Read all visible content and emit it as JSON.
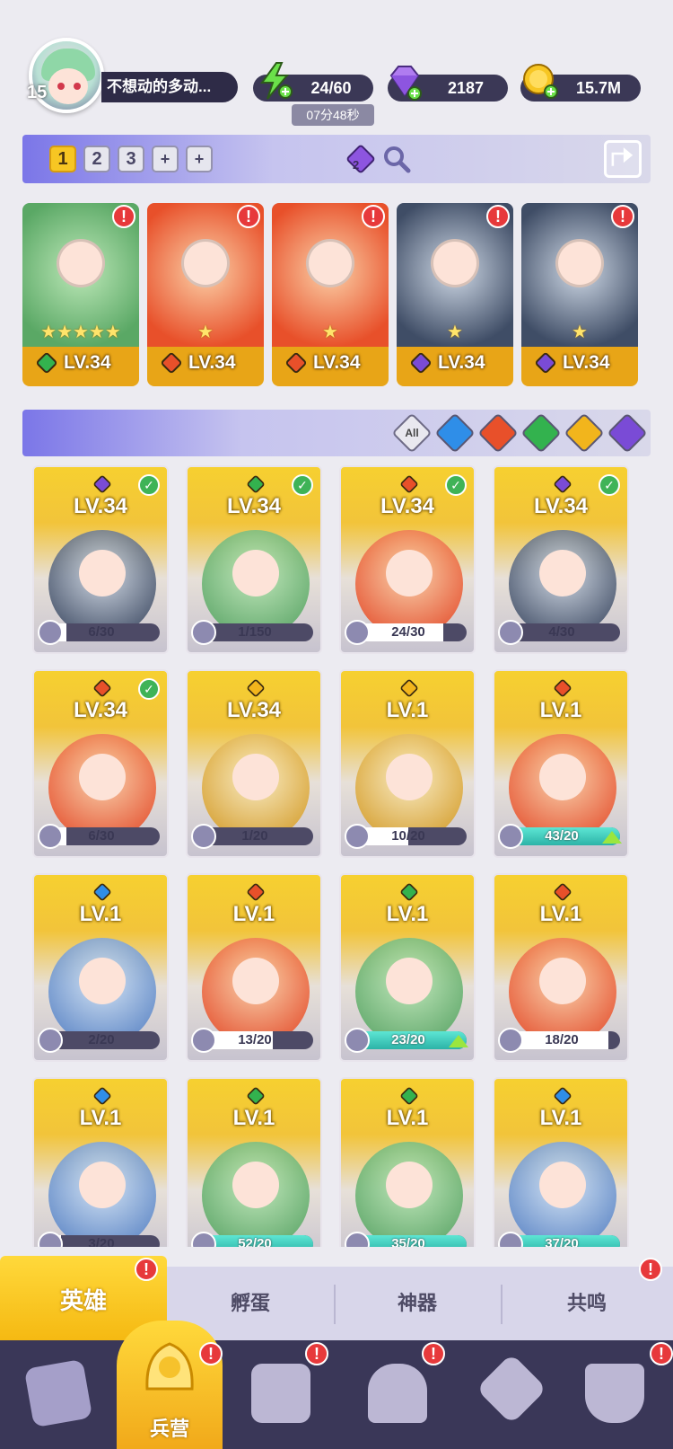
{
  "player": {
    "level": "15",
    "name": "不想动的多动..."
  },
  "resources": {
    "energy": "24/60",
    "energy_timer": "07分48秒",
    "gems": "2187",
    "gold": "15.7M"
  },
  "team_tabs": [
    "1",
    "2",
    "3",
    "+",
    "+"
  ],
  "team_cost_badge": "2",
  "team": [
    {
      "level": "LV.34",
      "element": "green",
      "stars": "★★★★★"
    },
    {
      "level": "LV.34",
      "element": "fire",
      "stars": "★"
    },
    {
      "level": "LV.34",
      "element": "fire",
      "stars": "★"
    },
    {
      "level": "LV.34",
      "element": "dark",
      "stars": "★"
    },
    {
      "level": "LV.34",
      "element": "dark",
      "stars": "★"
    }
  ],
  "filter_all_label": "All",
  "heroes": [
    {
      "level": "LV.34",
      "element": "dark",
      "owned": true,
      "progress": "6/30",
      "ratio": 0.2
    },
    {
      "level": "LV.34",
      "element": "green",
      "owned": true,
      "progress": "1/150",
      "ratio": 0.01
    },
    {
      "level": "LV.34",
      "element": "fire",
      "owned": true,
      "progress": "24/30",
      "ratio": 0.8
    },
    {
      "level": "LV.34",
      "element": "dark",
      "owned": true,
      "progress": "4/30",
      "ratio": 0.13
    },
    {
      "level": "LV.34",
      "element": "fire",
      "owned": true,
      "progress": "6/30",
      "ratio": 0.2
    },
    {
      "level": "LV.34",
      "element": "light",
      "owned": false,
      "progress": "1/20",
      "ratio": 0.05
    },
    {
      "level": "LV.1",
      "element": "light",
      "owned": false,
      "progress": "10/20",
      "ratio": 0.5
    },
    {
      "level": "LV.1",
      "element": "fire",
      "owned": false,
      "progress": "43/20",
      "ratio": 1.0,
      "upgrade": true
    },
    {
      "level": "LV.1",
      "element": "water",
      "owned": false,
      "progress": "2/20",
      "ratio": 0.1
    },
    {
      "level": "LV.1",
      "element": "fire",
      "owned": false,
      "progress": "13/20",
      "ratio": 0.65
    },
    {
      "level": "LV.1",
      "element": "green",
      "owned": false,
      "progress": "23/20",
      "ratio": 1.0,
      "upgrade": true
    },
    {
      "level": "LV.1",
      "element": "fire",
      "owned": false,
      "progress": "18/20",
      "ratio": 0.9
    },
    {
      "level": "LV.1",
      "element": "water",
      "owned": false,
      "progress": "3/20",
      "ratio": 0.15
    },
    {
      "level": "LV.1",
      "element": "green",
      "owned": false,
      "progress": "52/20",
      "ratio": 1.0
    },
    {
      "level": "LV.1",
      "element": "green",
      "owned": false,
      "progress": "35/20",
      "ratio": 1.0
    },
    {
      "level": "LV.1",
      "element": "water",
      "owned": false,
      "progress": "37/20",
      "ratio": 1.0
    }
  ],
  "sub_tabs": [
    "英雄",
    "孵蛋",
    "神器",
    "共鸣"
  ],
  "nav": {
    "active_label": "兵营"
  },
  "colors": {
    "fire": "#e8502a",
    "water": "#2f8ee8",
    "green": "#33b24e",
    "light": "#f2b51c",
    "dark": "#7a4bd6",
    "alert": "#e7393b"
  }
}
